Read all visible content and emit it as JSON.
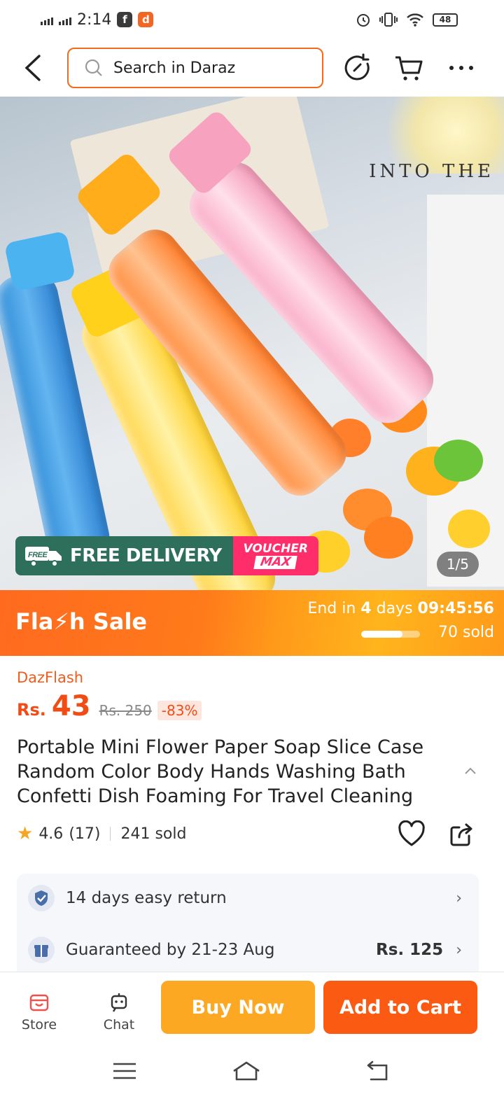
{
  "status_bar": {
    "time": "2:14",
    "battery": "48"
  },
  "search": {
    "placeholder": "Search in Daraz"
  },
  "hero": {
    "counter": "1/5",
    "free_delivery": "FREE DELIVERY",
    "free_tag": "FREE",
    "voucher_top": "VOUCHER",
    "voucher_bottom": "MAX",
    "overlay_text": "INTO THE"
  },
  "flash_sale": {
    "title": "Fla⚡h  Sale",
    "end_prefix": "End in",
    "days": "4",
    "days_label": "days",
    "countdown": "09:45:56",
    "sold": "70 sold",
    "progress": 0.7
  },
  "product": {
    "seller_tag": "DazFlash",
    "currency": "Rs.",
    "price": "43",
    "old_price": "Rs. 250",
    "discount": "-83%",
    "title": "Portable Mini Flower Paper Soap Slice Case Random Color Body Hands Washing Bath Confetti Dish Foaming For Travel Cleaning",
    "rating": "4.6",
    "reviews": "(17)",
    "sold": "241 sold"
  },
  "delivery": {
    "return_label": "14 days easy return",
    "guarantee_label": "Guaranteed by 21-23 Aug",
    "shipping_price": "Rs. 125"
  },
  "action_bar": {
    "store": "Store",
    "chat": "Chat",
    "buy_now": "Buy Now",
    "add_to_cart": "Add to Cart"
  },
  "colors": {
    "accent": "#f26a1b",
    "buy_now": "#fca822",
    "add_to_cart": "#fb5a12",
    "price": "#f24c16"
  }
}
